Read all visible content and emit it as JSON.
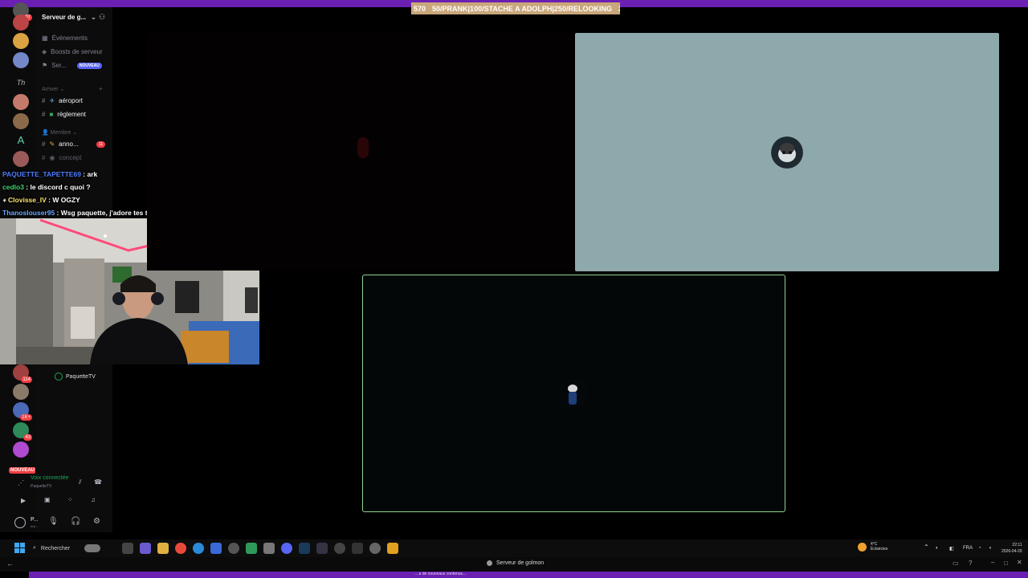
{
  "ticker": {
    "points": "570",
    "text": "50/PRANK|100/STACHE A ADOLPH|250/RELOOKING",
    "end_value": "250"
  },
  "server": {
    "name": "Serveur de g..."
  },
  "menu": {
    "events": "Événements",
    "boosts": "Boosts de serveur",
    "guide": "Ser...",
    "new_badge": "NOUVEAU"
  },
  "categories": {
    "arrive": "Arriver",
    "members": "Membre"
  },
  "channels": [
    {
      "name": "aéroport",
      "emoji_color": "#5fa8d3"
    },
    {
      "name": "règlement",
      "emoji_color": "#3ba55c"
    },
    {
      "name": "anno...",
      "badge": "11"
    },
    {
      "name": "concept"
    }
  ],
  "rail": {
    "top_badge": "97",
    "badges": [
      "114",
      "1K+",
      "43"
    ],
    "new_label": "NOUVEAU"
  },
  "chat": [
    {
      "user": "PAQUETTE_TAPETTE69",
      "user_color": "#4f7cff",
      "msg": "ark"
    },
    {
      "user": "cedlo3",
      "user_color": "#3fd36a",
      "msg": "le discord c quoi ?"
    },
    {
      "user": "Clovisse_IV",
      "user_color": "#ffe26a",
      "msg": "W OGZY"
    },
    {
      "user": "Thanoslouser95",
      "user_color": "#6aa8ff",
      "msg": "Wsg paquette, j'adore tes tiktok and shit"
    }
  ],
  "voice": {
    "channel_user": "PaquetteTV",
    "status": "Voix connectée",
    "sub": "PaquetteTV"
  },
  "user": {
    "name": "P...",
    "tag": "Invi..."
  },
  "taskbar": {
    "search": "Rechercher",
    "weather_temp": "4°C",
    "weather_desc": "Éclaircies",
    "lang": "FRA",
    "time": "22:11",
    "date": "2026-04-20"
  },
  "status_window": {
    "title": "Serveur de golmon"
  },
  "bottom_text": "... a de nouveaux contenus..."
}
